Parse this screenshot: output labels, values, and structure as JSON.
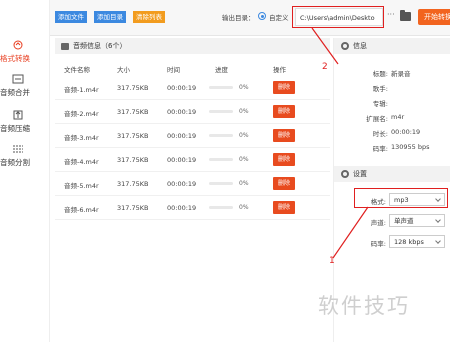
{
  "sidebar": {
    "items": [
      {
        "label": "格式转换",
        "icon": "format-convert-icon",
        "active": true
      },
      {
        "label": "音频合并",
        "icon": "merge-icon"
      },
      {
        "label": "音频压缩",
        "icon": "compress-icon"
      },
      {
        "label": "音频分割",
        "icon": "split-icon"
      }
    ]
  },
  "toolbar": {
    "add_file": "添加文件",
    "add_dir": "添加目录",
    "clear_list": "清除列表",
    "output_label": "输出目录：",
    "custom_label": "自定义",
    "output_path": "C:\\Users\\admin\\Deskto",
    "more": "···",
    "start": "开始转换"
  },
  "file_list": {
    "header": "音频信息（6个）",
    "columns": [
      "文件名称",
      "大小",
      "时间",
      "进度",
      "操作"
    ],
    "rows": [
      {
        "name": "音频-1.m4r",
        "size": "317.75KB",
        "time": "00:00:19",
        "progress": "0%",
        "action": "删除"
      },
      {
        "name": "音频-2.m4r",
        "size": "317.75KB",
        "time": "00:00:19",
        "progress": "0%",
        "action": "删除"
      },
      {
        "name": "音频-3.m4r",
        "size": "317.75KB",
        "time": "00:00:19",
        "progress": "0%",
        "action": "删除"
      },
      {
        "name": "音频-4.m4r",
        "size": "317.75KB",
        "time": "00:00:19",
        "progress": "0%",
        "action": "删除"
      },
      {
        "name": "音频-5.m4r",
        "size": "317.75KB",
        "time": "00:00:19",
        "progress": "0%",
        "action": "删除"
      },
      {
        "name": "音频-6.m4r",
        "size": "317.75KB",
        "time": "00:00:19",
        "progress": "0%",
        "action": "删除"
      }
    ]
  },
  "info": {
    "header": "信息",
    "fields": [
      {
        "key": "标题:",
        "value": "新录音"
      },
      {
        "key": "歌手:",
        "value": ""
      },
      {
        "key": "专辑:",
        "value": ""
      },
      {
        "key": "扩展名:",
        "value": "m4r"
      },
      {
        "key": "时长:",
        "value": "00:00:19"
      },
      {
        "key": "码率:",
        "value": "130955 bps"
      }
    ]
  },
  "settings": {
    "header": "设置",
    "format_label": "格式:",
    "format_value": "mp3",
    "channel_label": "声道:",
    "channel_value": "单声道",
    "bitrate_label": "码率:",
    "bitrate_value": "128 kbps"
  },
  "annotations": {
    "one": "1",
    "two": "2"
  },
  "watermark": "软件技巧",
  "colors": {
    "accent": "#e83d1f",
    "blue": "#3c89e0",
    "orange": "#f29c1f",
    "annotation": "#e02020"
  }
}
